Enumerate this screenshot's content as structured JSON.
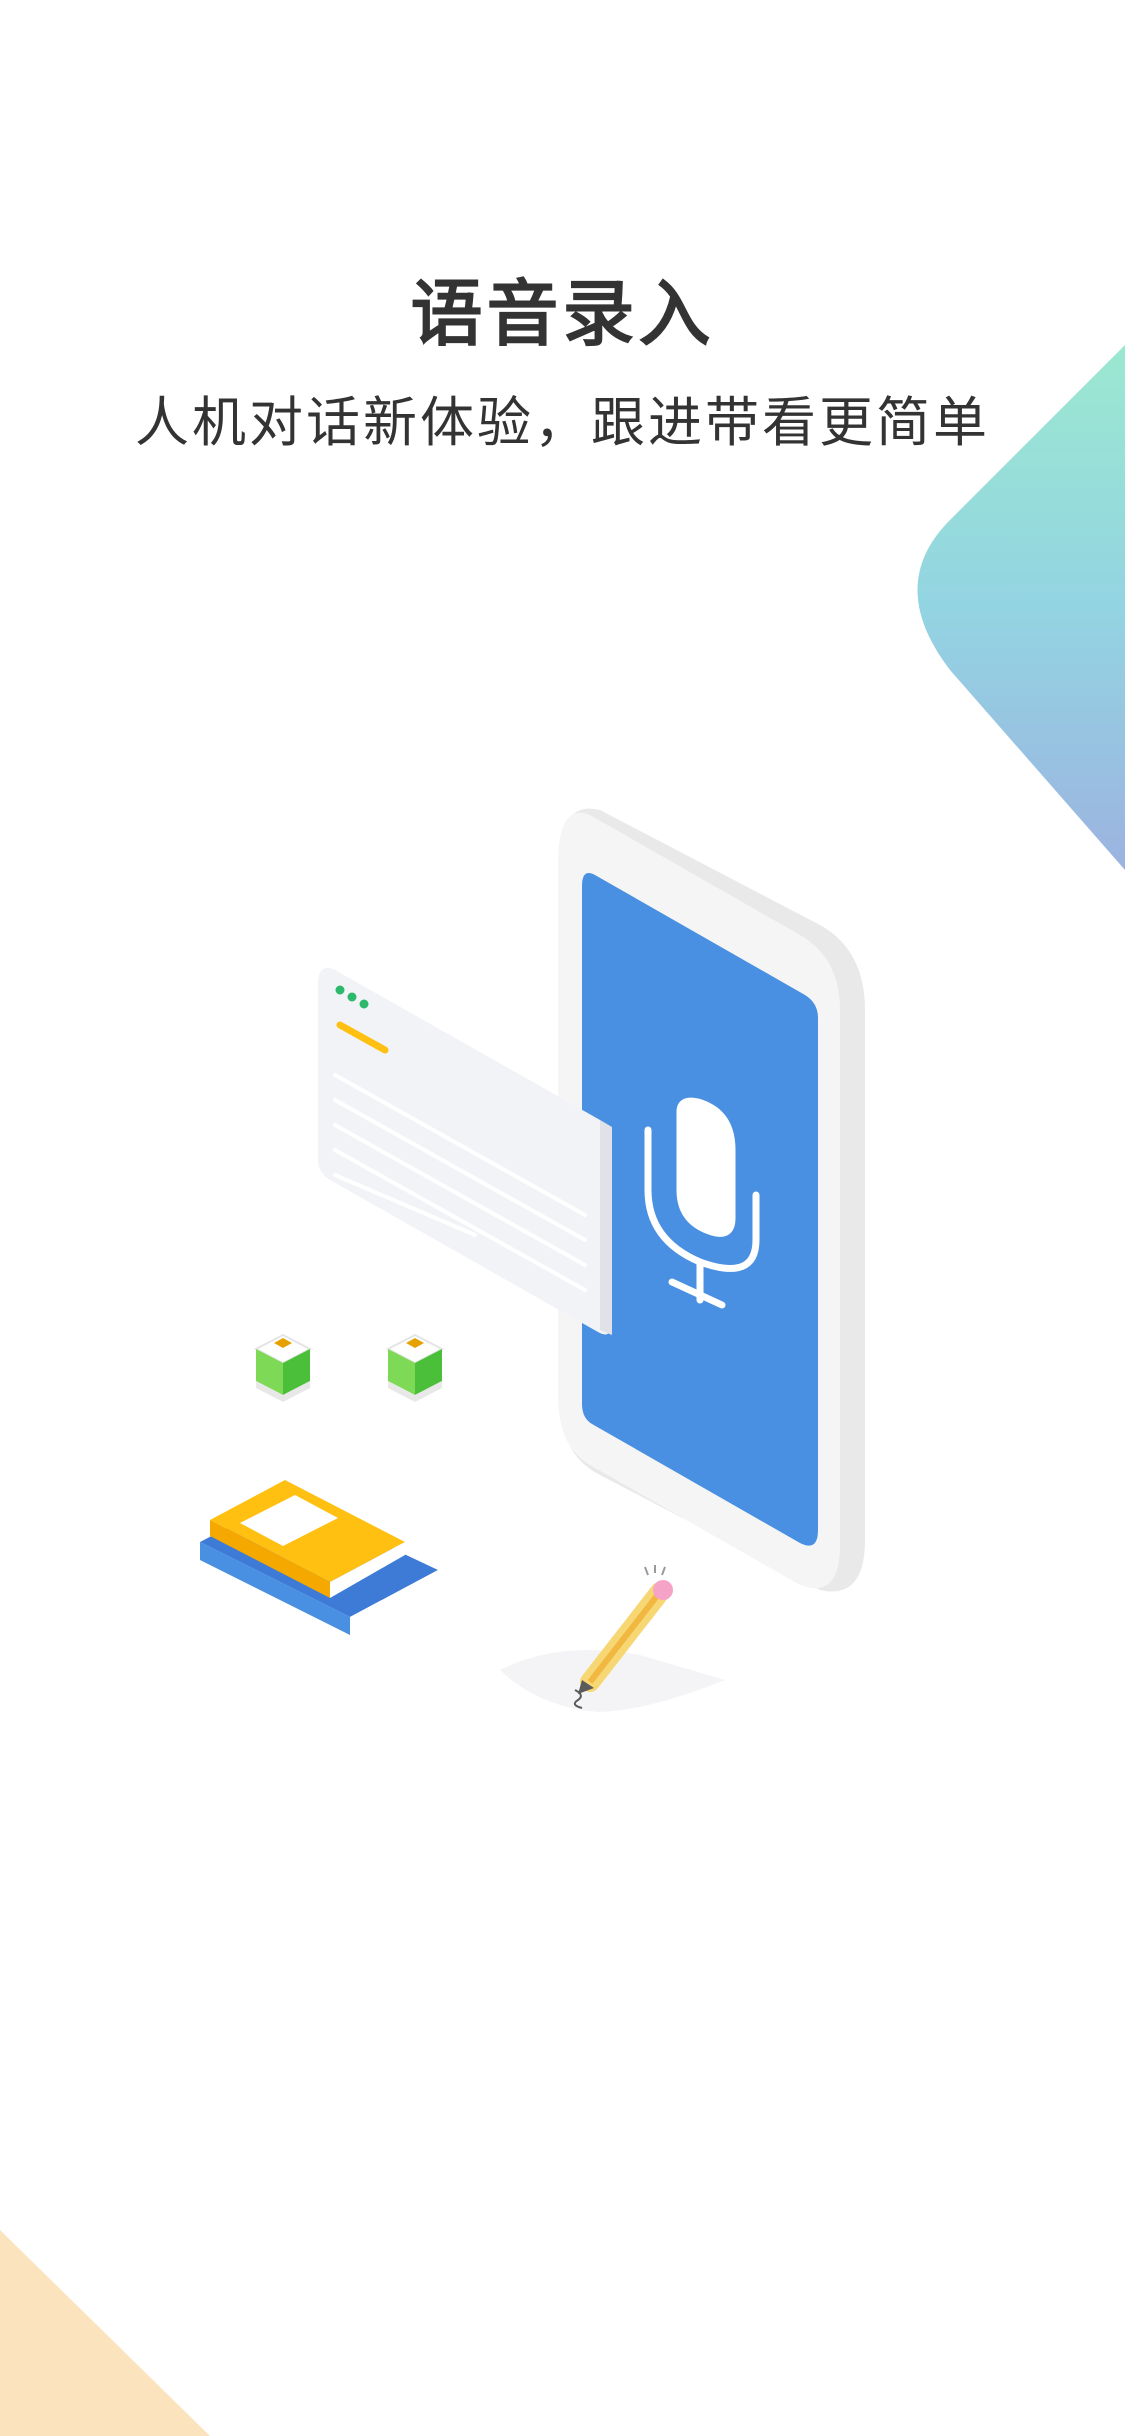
{
  "intro": {
    "title": "语音录入",
    "subtitle": "人机对话新体验，跟进带看更简单"
  },
  "colors": {
    "phone_screen": "#4A90E2",
    "gradient_top": "#9BE8D0",
    "gradient_bottom": "#9CB3E0",
    "corner_peach": "#FBE3BE",
    "book_yellow": "#FFC012",
    "book_blue": "#4A90E2",
    "dots_green": "#2EB86B"
  },
  "icons": {
    "microphone": "microphone-icon"
  }
}
